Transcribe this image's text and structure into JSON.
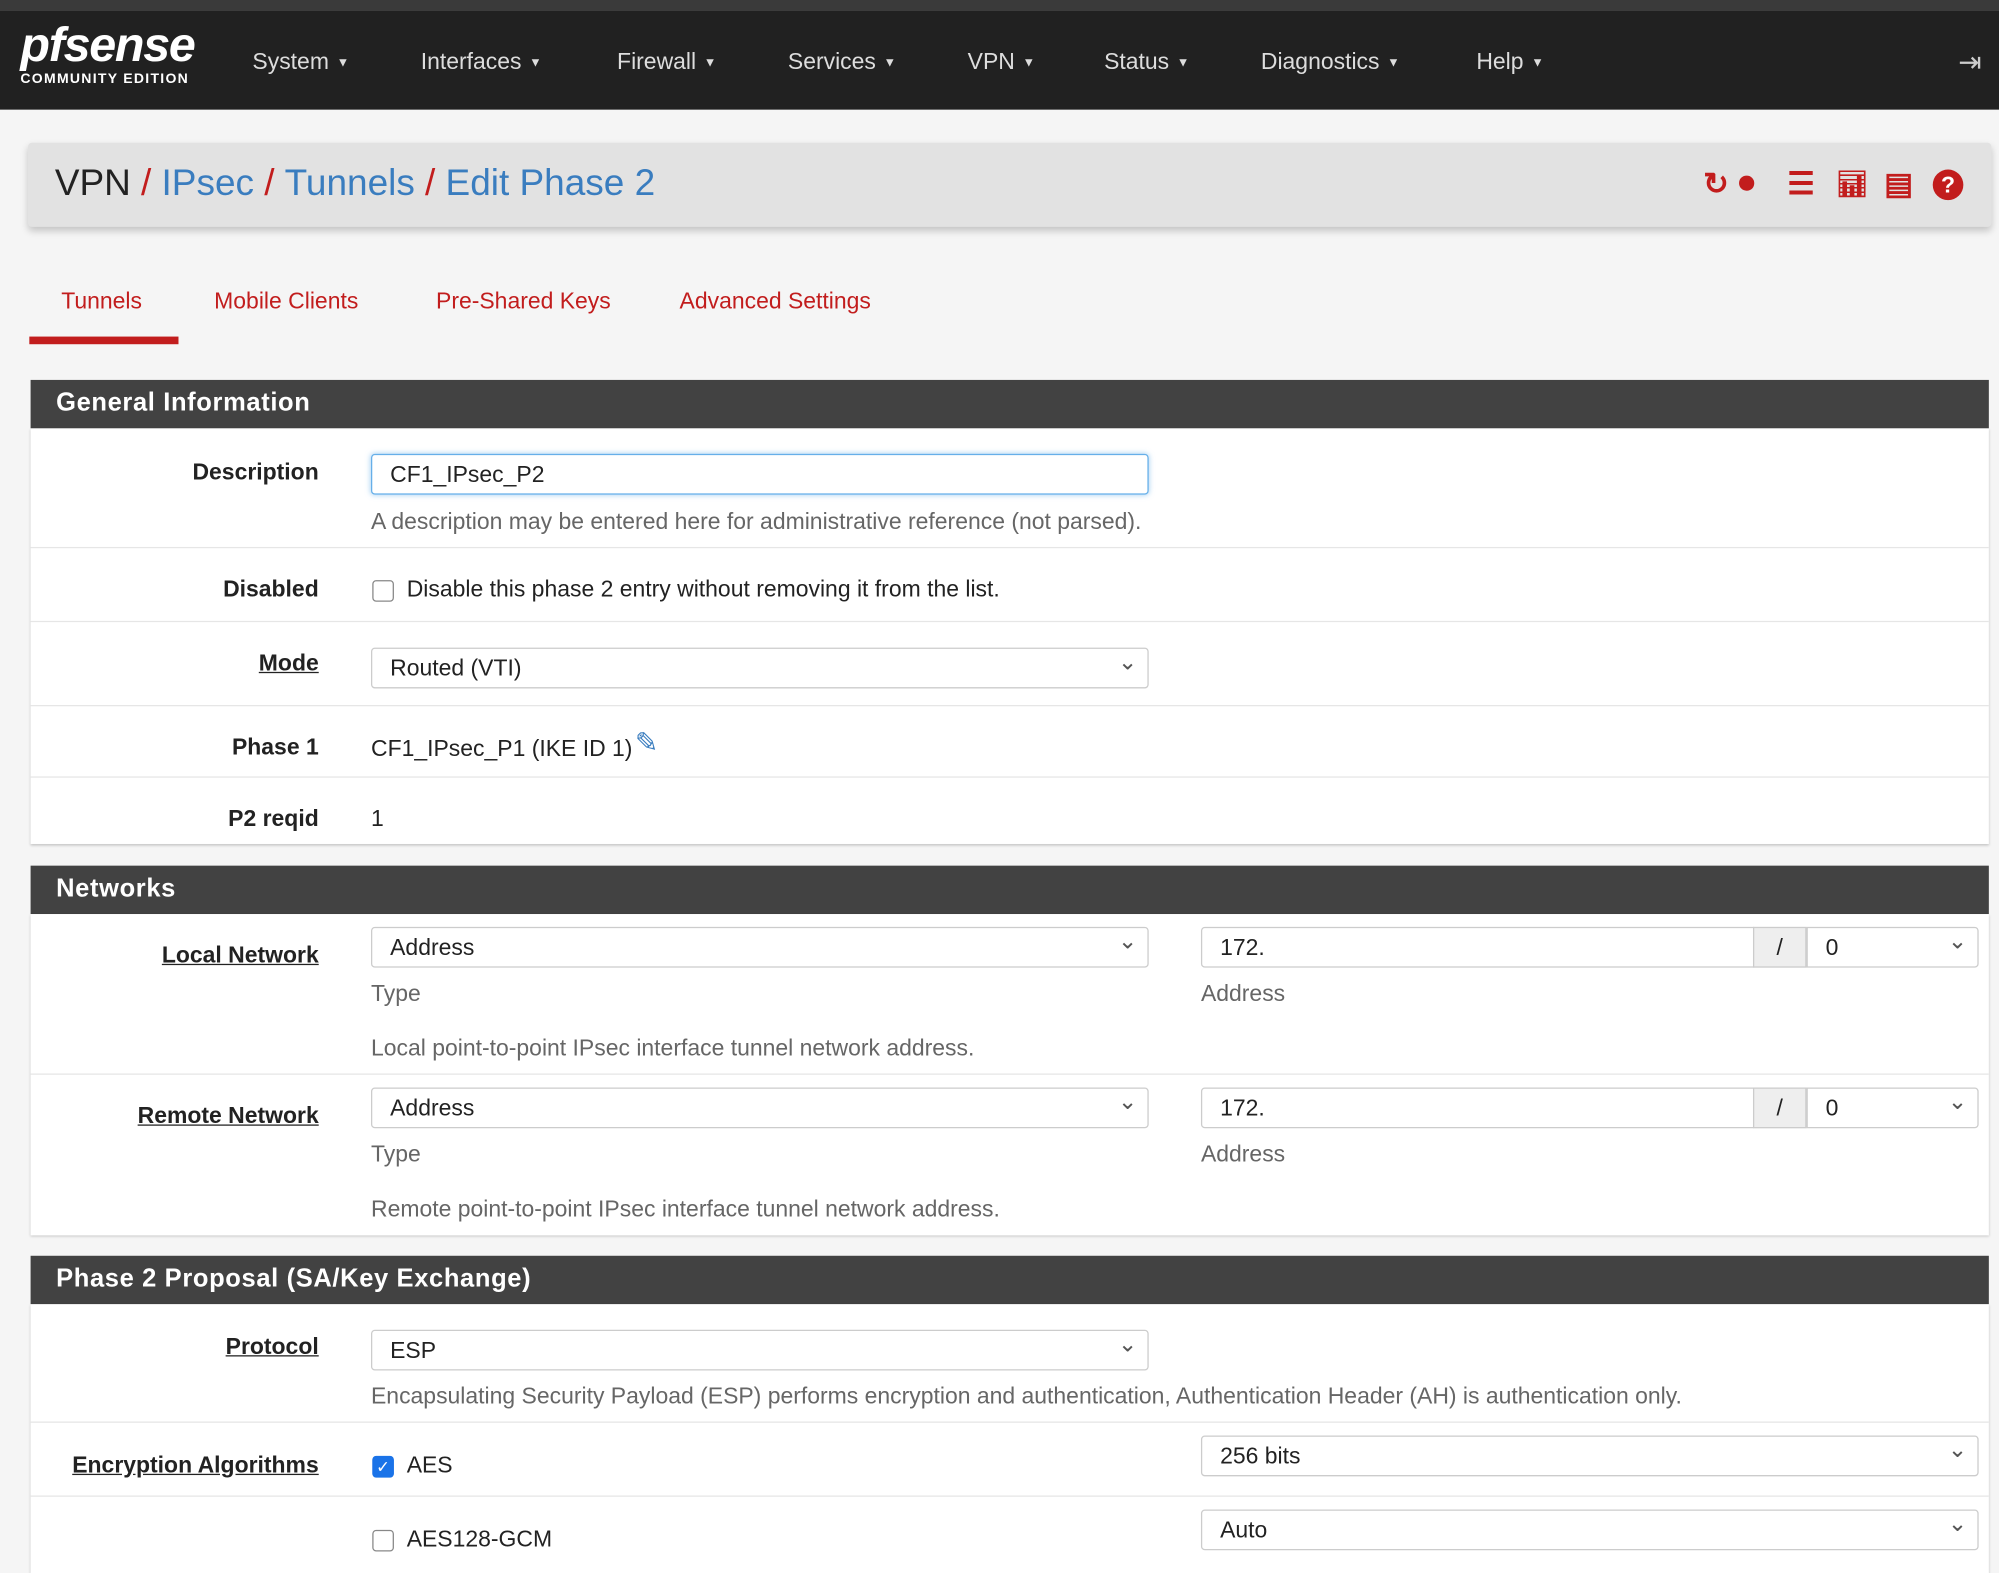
{
  "navbar": {
    "logo_text": "pfsense",
    "logo_subtitle": "COMMUNITY EDITION",
    "items": [
      "System",
      "Interfaces",
      "Firewall",
      "Services",
      "VPN",
      "Status",
      "Diagnostics",
      "Help"
    ]
  },
  "breadcrumb": {
    "root": "VPN",
    "items": [
      "IPsec",
      "Tunnels",
      "Edit Phase 2"
    ],
    "separator": "/"
  },
  "tabs": [
    {
      "label": "Tunnels",
      "active": true
    },
    {
      "label": "Mobile Clients"
    },
    {
      "label": "Pre-Shared Keys"
    },
    {
      "label": "Advanced Settings"
    }
  ],
  "colors": {
    "accent": "#c21d1d",
    "link": "#3a7dbf",
    "navbar": "#212121",
    "panel_heading": "#424242"
  },
  "general": {
    "title": "General Information",
    "description": {
      "label": "Description",
      "value": "CF1_IPsec_P2",
      "help": "A description may be entered here for administrative reference (not parsed)."
    },
    "disabled": {
      "label": "Disabled",
      "checked": false,
      "text": "Disable this phase 2 entry without removing it from the list."
    },
    "mode": {
      "label": "Mode",
      "value": "Routed (VTI)"
    },
    "phase1": {
      "label": "Phase 1",
      "value": "CF1_IPsec_P1 (IKE ID 1)"
    },
    "p2reqid": {
      "label": "P2 reqid",
      "value": "1"
    }
  },
  "networks": {
    "title": "Networks",
    "local": {
      "label": "Local Network",
      "type": "Address",
      "type_label": "Type",
      "address": "172.",
      "address_label": "Address",
      "slash": "/",
      "mask": "0",
      "help": "Local point-to-point IPsec interface tunnel network address."
    },
    "remote": {
      "label": "Remote Network",
      "type": "Address",
      "type_label": "Type",
      "address": "172.",
      "address_label": "Address",
      "slash": "/",
      "mask": "0",
      "help": "Remote point-to-point IPsec interface tunnel network address."
    }
  },
  "proposal": {
    "title": "Phase 2 Proposal (SA/Key Exchange)",
    "protocol": {
      "label": "Protocol",
      "value": "ESP",
      "help": "Encapsulating Security Payload (ESP) performs encryption and authentication, Authentication Header (AH) is authentication only."
    },
    "encryption": {
      "label": "Encryption Algorithms",
      "items": [
        {
          "name": "AES",
          "checked": true,
          "keylen": "256 bits"
        },
        {
          "name": "AES128-GCM",
          "checked": false,
          "keylen": "Auto"
        }
      ]
    }
  }
}
